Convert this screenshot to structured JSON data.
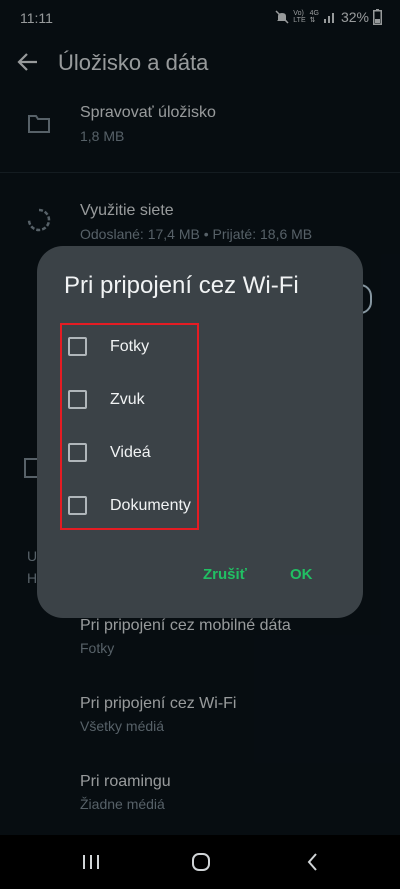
{
  "status": {
    "time": "11:11",
    "battery": "32%",
    "net_top": "Vo)",
    "net_bottom": "LTE",
    "gen": "4G"
  },
  "appbar": {
    "title": "Úložisko a dáta"
  },
  "list": {
    "storage": {
      "title": "Spravovať úložisko",
      "subtitle": "1,8 MB"
    },
    "network": {
      "title": "Využitie siete",
      "subtitle": "Odoslané: 17,4 MB • Prijaté: 18,6 MB"
    },
    "partial_u": "U",
    "partial_h": "H",
    "mobile": {
      "title": "Pri pripojení cez mobilné dáta",
      "subtitle": "Fotky"
    },
    "wifi": {
      "title": "Pri pripojení cez Wi-Fi",
      "subtitle": "Všetky médiá"
    },
    "roaming": {
      "title": "Pri roamingu",
      "subtitle": "Žiadne médiá"
    }
  },
  "dialog": {
    "title": "Pri pripojení cez Wi-Fi",
    "options": [
      {
        "label": "Fotky",
        "checked": false
      },
      {
        "label": "Zvuk",
        "checked": false
      },
      {
        "label": "Videá",
        "checked": false
      },
      {
        "label": "Dokumenty",
        "checked": false
      }
    ],
    "cancel": "Zrušiť",
    "ok": "OK"
  },
  "colors": {
    "accent": "#21c063",
    "highlight": "#e51c23",
    "dialog_bg": "#3b4247",
    "app_bg": "#0b141b"
  }
}
